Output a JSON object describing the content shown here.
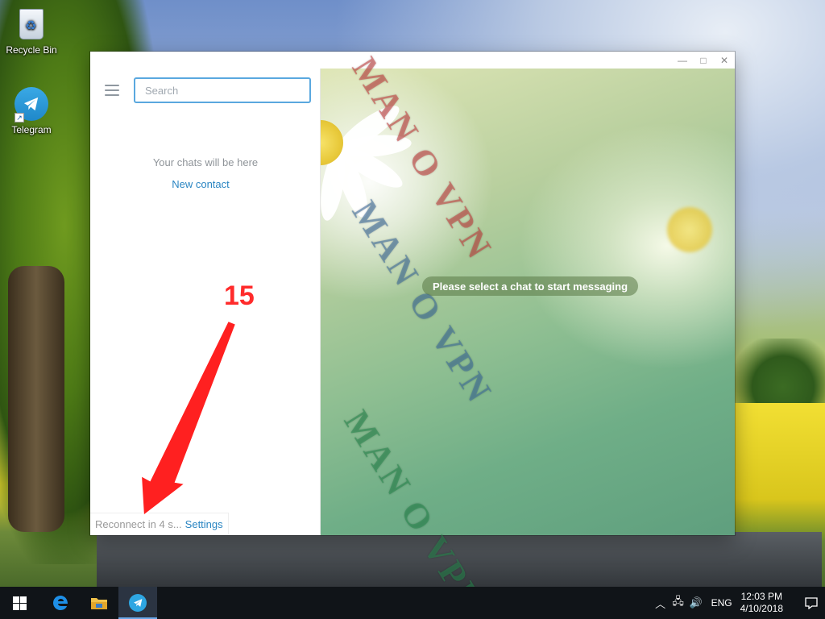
{
  "desktop": {
    "icons": [
      {
        "label": "Recycle Bin",
        "icon": "recycle-bin-icon"
      },
      {
        "label": "Telegram",
        "icon": "telegram-icon"
      }
    ]
  },
  "window": {
    "controls": {
      "minimize": "—",
      "maximize": "□",
      "close": "✕"
    }
  },
  "sidebar": {
    "search_placeholder": "Search",
    "empty_text": "Your chats will be here",
    "new_contact": "New contact",
    "status": {
      "reconnect": "Reconnect in 4 s...",
      "settings": "Settings"
    }
  },
  "chat": {
    "empty_message": "Please select a chat to start messaging"
  },
  "watermark": {
    "text": "MAN O VPN"
  },
  "annotation": {
    "number": "15",
    "color": "#ff2b2b"
  },
  "taskbar": {
    "apps": [
      {
        "name": "start",
        "icon": "windows-icon"
      },
      {
        "name": "edge",
        "icon": "edge-icon"
      },
      {
        "name": "file-explorer",
        "icon": "folder-icon"
      },
      {
        "name": "telegram",
        "icon": "telegram-icon",
        "active": true
      }
    ],
    "tray": {
      "language": "ENG",
      "time": "12:03 PM",
      "date": "4/10/2018"
    }
  },
  "colors": {
    "accent": "#2a85c2",
    "search_border": "#5aa8df",
    "taskbar": "#101418"
  }
}
